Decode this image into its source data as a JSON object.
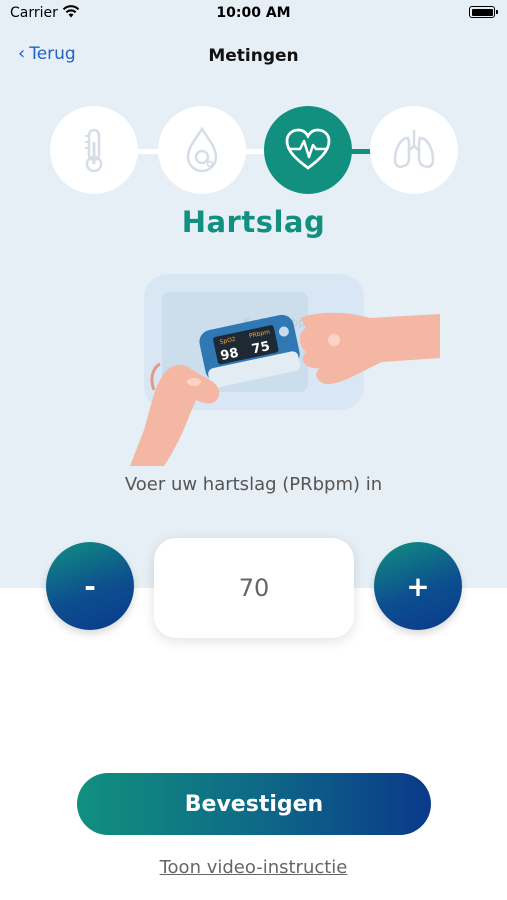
{
  "status_bar": {
    "carrier": "Carrier",
    "time": "10:00 AM"
  },
  "nav": {
    "back_label": "Terug",
    "title": "Metingen"
  },
  "steps": [
    {
      "icon": "thermometer-icon",
      "state": "inactive"
    },
    {
      "icon": "oxygen-drop-icon",
      "state": "inactive"
    },
    {
      "icon": "heart-rate-icon",
      "state": "active"
    },
    {
      "icon": "lungs-icon",
      "state": "inactive"
    }
  ],
  "section_title": "Hartslag",
  "illustration": {
    "icon": "pulse-oximeter-illustration",
    "device_label": "SpO2 PRbpm",
    "spo2_value": "98",
    "pr_value": "75"
  },
  "instruction": "Voer uw hartslag (PRbpm) in",
  "stepper": {
    "minus_label": "-",
    "value": "70",
    "plus_label": "+"
  },
  "confirm_label": "Bevestigen",
  "video_link": "Toon video-instructie",
  "colors": {
    "accent": "#11907f",
    "link": "#1f63c4",
    "navy": "#0a3a8a",
    "background": "#e6eef6"
  }
}
